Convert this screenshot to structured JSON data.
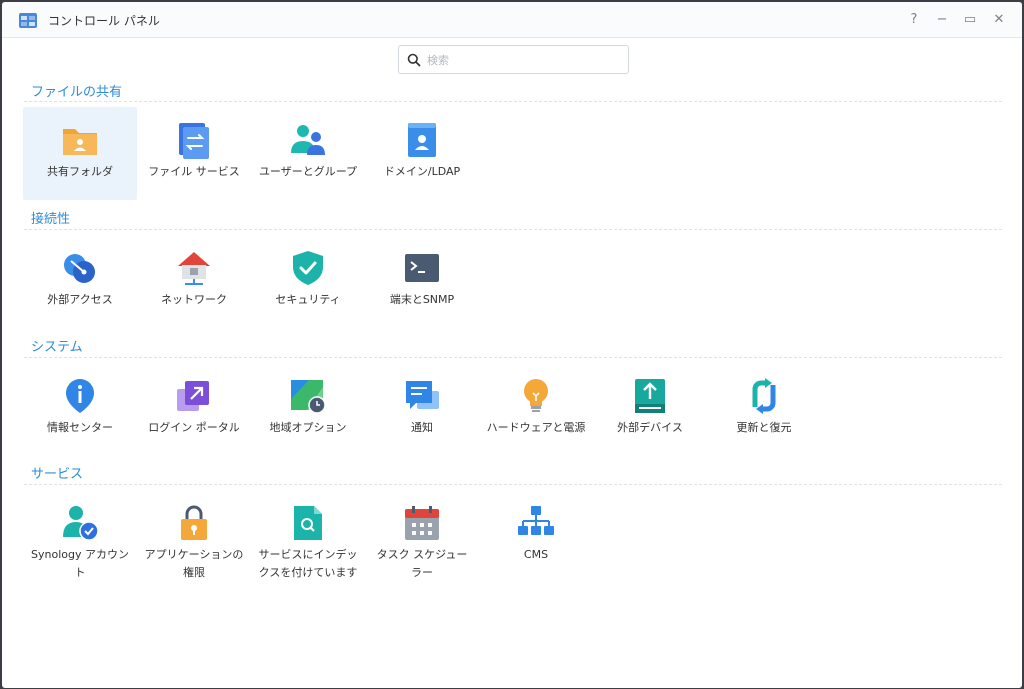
{
  "window": {
    "title": "コントロール パネル"
  },
  "search": {
    "placeholder": "検索"
  },
  "sections": [
    {
      "title": "ファイルの共有",
      "items": [
        {
          "label": "共有フォルダ",
          "icon": "shared-folder-icon"
        },
        {
          "label": "ファイル サービス",
          "icon": "file-services-icon"
        },
        {
          "label": "ユーザーとグループ",
          "icon": "user-group-icon"
        },
        {
          "label": "ドメイン/LDAP",
          "icon": "domain-ldap-icon"
        }
      ]
    },
    {
      "title": "接続性",
      "items": [
        {
          "label": "外部アクセス",
          "icon": "external-access-icon"
        },
        {
          "label": "ネットワーク",
          "icon": "network-icon"
        },
        {
          "label": "セキュリティ",
          "icon": "security-shield-icon"
        },
        {
          "label": "端末とSNMP",
          "icon": "terminal-icon"
        }
      ]
    },
    {
      "title": "システム",
      "items": [
        {
          "label": "情報センター",
          "icon": "info-center-icon"
        },
        {
          "label": "ログイン ポータル",
          "icon": "login-portal-icon"
        },
        {
          "label": "地域オプション",
          "icon": "regional-options-icon"
        },
        {
          "label": "通知",
          "icon": "notification-icon"
        },
        {
          "label": "ハードウェアと電源",
          "icon": "hardware-power-icon"
        },
        {
          "label": "外部デバイス",
          "icon": "external-devices-icon"
        },
        {
          "label": "更新と復元",
          "icon": "update-restore-icon"
        }
      ]
    },
    {
      "title": "サービス",
      "items": [
        {
          "label": "Synology アカウン\nト",
          "icon": "synology-account-icon"
        },
        {
          "label": "アプリケーションの\n権限",
          "icon": "application-privileges-icon"
        },
        {
          "label": "サービスにインデッ\nクスを付けています",
          "icon": "indexing-service-icon"
        },
        {
          "label": "タスク スケジュー\nラー",
          "icon": "task-scheduler-icon"
        },
        {
          "label": "CMS",
          "icon": "cms-icon"
        }
      ]
    }
  ],
  "selected": "共有フォルダ",
  "controls": {
    "help": "?",
    "minimize": "−",
    "maximize": "▭",
    "close": "✕"
  },
  "colors": {
    "accent": "#2e8bd9",
    "selected_bg": "#eaf2fb"
  }
}
